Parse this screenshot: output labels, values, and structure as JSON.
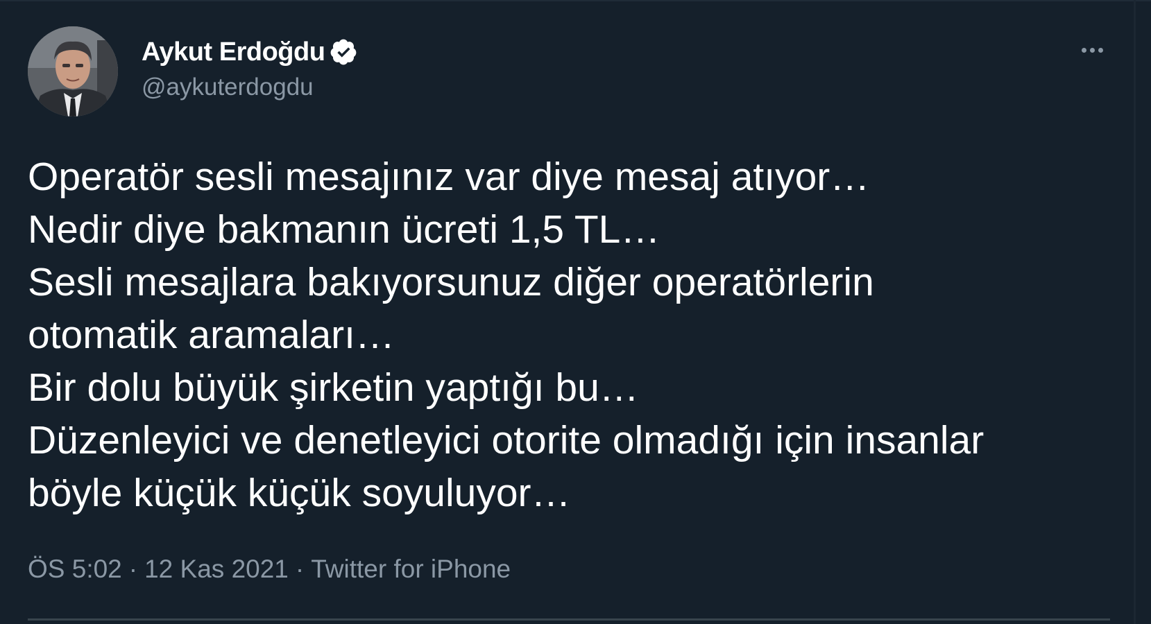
{
  "author": {
    "display_name": "Aykut Erdoğdu",
    "handle": "@aykuterdogdu",
    "verified": true
  },
  "tweet": {
    "lines": [
      "Operatör sesli mesajınız var diye mesaj atıyor…",
      "Nedir diye bakmanın ücreti 1,5 TL…",
      "Sesli mesajlara bakıyorsunuz diğer operatörlerin",
      "otomatik aramaları…",
      "Bir dolu büyük şirketin yaptığı bu…",
      "Düzenleyici ve denetleyici otorite olmadığı için insanlar",
      "böyle küçük küçük soyuluyor…"
    ]
  },
  "meta": {
    "time": "ÖS 5:02",
    "separator": "·",
    "date": "12 Kas 2021",
    "source": "Twitter for iPhone"
  },
  "icons": {
    "verified": "verified-badge-icon",
    "more": "more-options-icon"
  },
  "colors": {
    "background": "#15202b",
    "text": "#ffffff",
    "secondary_text": "#8b98a5"
  }
}
